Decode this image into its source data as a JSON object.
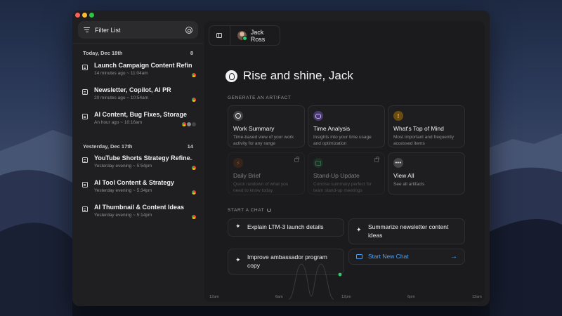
{
  "sidebar": {
    "filter_label": "Filter List",
    "groups": [
      {
        "date": "Today, Dec 18th",
        "count": "8",
        "items": [
          {
            "title": "Launch Campaign Content Refin...",
            "meta": "14 minutes ago ~ 11:04am"
          },
          {
            "title": "Newsletter, Copilot, AI PR",
            "meta": "20 minutes ago ~ 10:54am"
          },
          {
            "title": "AI Content, Bug Fixes, Storage",
            "meta": "An hour ago ~ 10:16am"
          }
        ]
      },
      {
        "date": "Yesterday, Dec 17th",
        "count": "14",
        "items": [
          {
            "title": "YouTube Shorts Strategy Refine...",
            "meta": "Yesterday evening ~ 5:54pm"
          },
          {
            "title": "AI Tool Content & Strategy",
            "meta": "Yesterday evening ~ 5:34pm"
          },
          {
            "title": "AI Thumbnail & Content Ideas",
            "meta": "Yesterday evening ~ 5:14pm"
          }
        ]
      }
    ]
  },
  "header": {
    "user_name": "Jack Ross"
  },
  "main": {
    "greeting": "Rise and shine, Jack",
    "artifact_label": "GENERATE AN ARTIFACT",
    "cards": [
      {
        "title": "Work Summary",
        "desc": "Time-based view of your work activity for any range",
        "icon": "clock-icon"
      },
      {
        "title": "Time Analysis",
        "desc": "Insights into your time usage and optimization",
        "icon": "brain-icon"
      },
      {
        "title": "What's Top of Mind",
        "desc": "Most important and frequently accessed items",
        "icon": "alert-icon",
        "glyph": "!"
      },
      {
        "title": "Daily Brief",
        "desc": "Quick rundown of what you need to know today",
        "icon": "bolt-icon",
        "glyph": "⚡"
      },
      {
        "title": "Stand-Up Update",
        "desc": "Concise summary perfect for team stand-up meetings",
        "icon": "calendar-icon"
      },
      {
        "title": "View All",
        "desc": "See all artifacts",
        "icon": "dots-icon",
        "glyph": "•••"
      }
    ],
    "chat_label": "START A CHAT",
    "prompts": [
      "Explain LTM-3 launch details",
      "Summarize newsletter content ideas",
      "Improve ambassador program copy"
    ],
    "new_chat_label": "Start New Chat",
    "timeline_ticks": [
      "12am",
      "6am",
      "12pm",
      "6pm",
      "12am"
    ]
  },
  "colors": {
    "accent": "#4aa3ff",
    "online": "#2ecc71",
    "window_bg": "#1f1f21",
    "main_bg": "#1b1b1d"
  }
}
